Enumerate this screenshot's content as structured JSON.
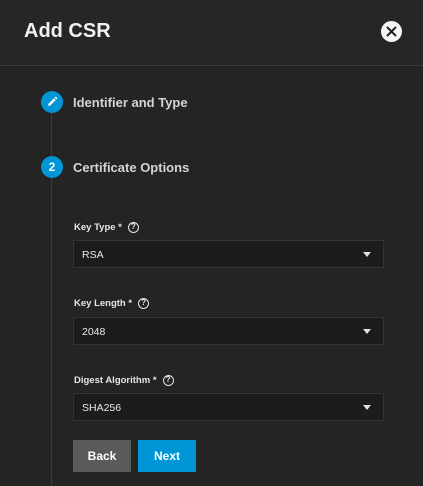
{
  "dialog": {
    "title": "Add CSR",
    "close_icon": "close-icon"
  },
  "steps": [
    {
      "number": "",
      "icon": "pencil-icon",
      "label": "Identifier and Type"
    },
    {
      "number": "2",
      "label": "Certificate Options"
    }
  ],
  "form": {
    "key_type": {
      "label": "Key Type *",
      "value": "RSA"
    },
    "key_length": {
      "label": "Key Length *",
      "value": "2048"
    },
    "digest_algorithm": {
      "label": "Digest Algorithm *",
      "value": "SHA256"
    },
    "help_glyph": "?"
  },
  "buttons": {
    "back": "Back",
    "next": "Next"
  },
  "colors": {
    "accent": "#0095d5",
    "background": "#242424",
    "back_button": "#5a5a5a"
  }
}
